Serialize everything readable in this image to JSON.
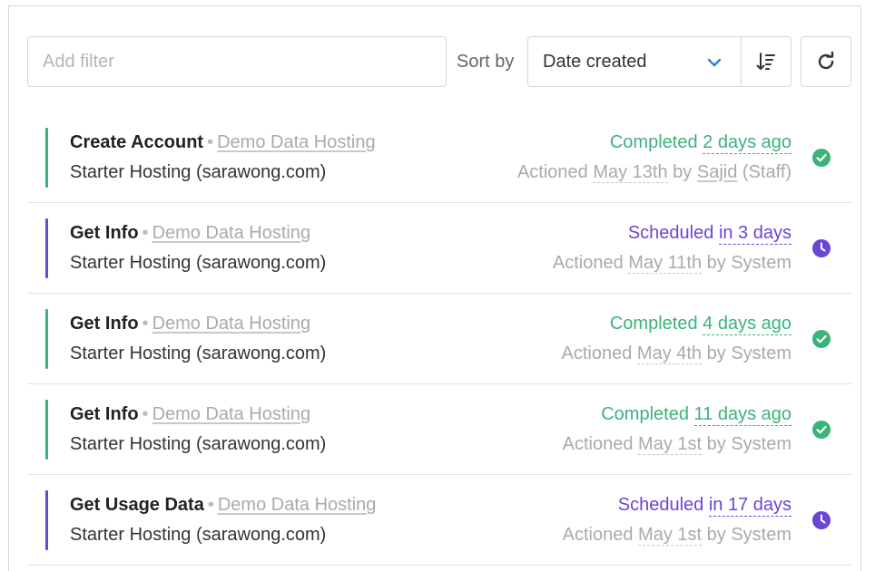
{
  "toolbar": {
    "filter_placeholder": "Add filter",
    "sort_label": "Sort by",
    "sort_value": "Date created",
    "icons": {
      "chevron": "chevron-down-icon",
      "sort_direction": "sort-descending-icon",
      "refresh": "refresh-icon"
    }
  },
  "colors": {
    "completed": "#3bb27a",
    "scheduled": "#6a45d6",
    "accent": "#2f7de1"
  },
  "rows": [
    {
      "action": "Create Account",
      "source": "Demo Data Hosting",
      "service": "Starter Hosting (sarawong.com)",
      "status_word": "Completed",
      "status_when": "2 days ago",
      "actioned_prefix": "Actioned",
      "actioned_date": "May 13th",
      "actioned_by_prefix": "by",
      "actioned_by": "Sajid",
      "actioned_role": "(Staff)",
      "state": "completed"
    },
    {
      "action": "Get Info",
      "source": "Demo Data Hosting",
      "service": "Starter Hosting (sarawong.com)",
      "status_word": "Scheduled",
      "status_when": "in 3 days",
      "actioned_prefix": "Actioned",
      "actioned_date": "May 11th",
      "actioned_by_prefix": "by",
      "actioned_by": "System",
      "actioned_role": "",
      "state": "scheduled"
    },
    {
      "action": "Get Info",
      "source": "Demo Data Hosting",
      "service": "Starter Hosting (sarawong.com)",
      "status_word": "Completed",
      "status_when": "4 days ago",
      "actioned_prefix": "Actioned",
      "actioned_date": "May 4th",
      "actioned_by_prefix": "by",
      "actioned_by": "System",
      "actioned_role": "",
      "state": "completed"
    },
    {
      "action": "Get Info",
      "source": "Demo Data Hosting",
      "service": "Starter Hosting (sarawong.com)",
      "status_word": "Completed",
      "status_when": "11 days ago",
      "actioned_prefix": "Actioned",
      "actioned_date": "May 1st",
      "actioned_by_prefix": "by",
      "actioned_by": "System",
      "actioned_role": "",
      "state": "completed"
    },
    {
      "action": "Get Usage Data",
      "source": "Demo Data Hosting",
      "service": "Starter Hosting (sarawong.com)",
      "status_word": "Scheduled",
      "status_when": "in 17 days",
      "actioned_prefix": "Actioned",
      "actioned_date": "May 1st",
      "actioned_by_prefix": "by",
      "actioned_by": "System",
      "actioned_role": "",
      "state": "scheduled"
    }
  ]
}
